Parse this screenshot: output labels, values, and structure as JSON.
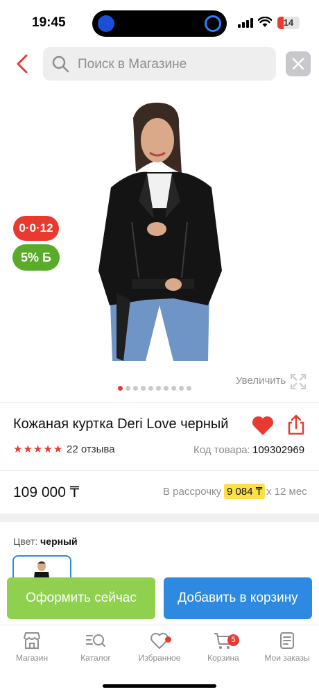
{
  "status_bar": {
    "time": "19:45",
    "battery": "14"
  },
  "search": {
    "placeholder": "Поиск в Магазине"
  },
  "product": {
    "badge_red": "0·0·12",
    "badge_green": "5% Б",
    "zoom_label": "Увеличить",
    "title": "Кожаная куртка Deri Love черный",
    "rating_stars": 5,
    "reviews": "22 отзыва",
    "sku_label": "Код товара:",
    "sku": "109302969",
    "price": "109 000 ₸",
    "installment_label": "В рассрочку",
    "installment_amount": "9 084 ₸",
    "installment_term": "х 12 мес",
    "color_label": "Цвет:",
    "color_value": "черный",
    "image_count": 10,
    "active_image": 1
  },
  "actions": {
    "checkout_now": "Оформить сейчас",
    "add_to_cart": "Добавить в корзину"
  },
  "tabbar": {
    "items": [
      {
        "label": "Магазин",
        "icon": "store-icon"
      },
      {
        "label": "Каталог",
        "icon": "catalog-search-icon"
      },
      {
        "label": "Избранное",
        "icon": "heart-icon"
      },
      {
        "label": "Корзина",
        "icon": "cart-icon",
        "badge": "5"
      },
      {
        "label": "Мои заказы",
        "icon": "orders-icon"
      }
    ]
  },
  "colors": {
    "accent_red": "#e83a2f",
    "checkout_green": "#8fd14f",
    "cart_blue": "#2d8ae0",
    "installment_yellow": "#fde047"
  }
}
